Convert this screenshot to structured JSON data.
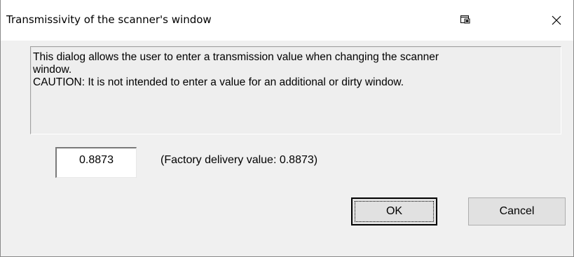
{
  "window": {
    "title": "Transmissivity of the scanner's window",
    "icons": {
      "system_menu": "window-menu-icon",
      "close": "close-icon"
    }
  },
  "message": {
    "line1": "This dialog allows the user to enter a transmission value when changing the scanner",
    "line2": "window.",
    "line3": " CAUTION: It is not intended to enter a value for an additional or dirty window."
  },
  "transmission": {
    "value": "0.8873",
    "factory_label": "(Factory delivery value: 0.8873)"
  },
  "buttons": {
    "ok_label": "OK",
    "cancel_label": "Cancel"
  }
}
